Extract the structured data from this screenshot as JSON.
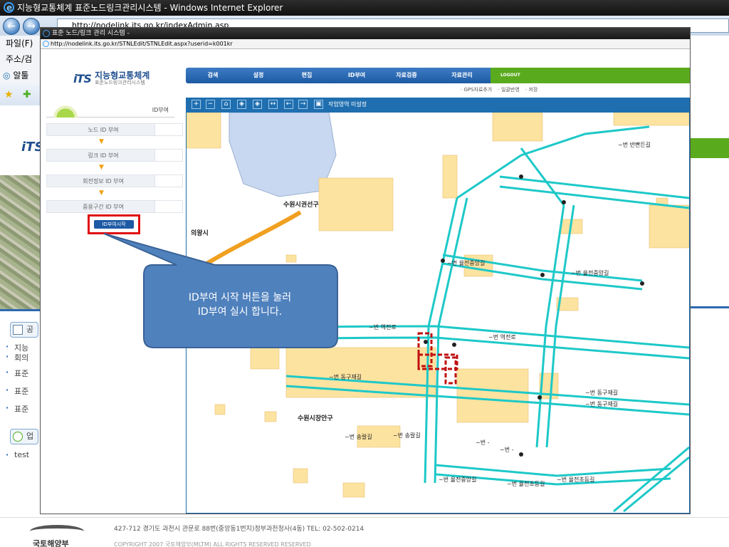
{
  "outer_window": {
    "title": "지능형교통체계 표준노드링크관리시스템 - Windows Internet Explorer",
    "address": "http://nodelink.its.go.kr/indexAdmin.asp",
    "menu_label": "파일(F)",
    "address_label": "주소/검",
    "links_label": "알툴"
  },
  "outer_page": {
    "logo_mark": "iTS",
    "news_items": [
      "지능",
      "회의",
      "표준",
      "표준",
      "표준"
    ],
    "news_title_1": "공",
    "news_title_2": "업",
    "news_item_bottom": "test"
  },
  "popup": {
    "title": "표준 노드/링크 관리 시스템 -",
    "address": "http://nodelink.its.go.kr/STNLEdit/STNLEdit.aspx?userid=k001kr"
  },
  "header": {
    "logo_mark": "iTS",
    "logo_title": "지능형교통체계",
    "logo_subtitle": "표준노드링크관리시스템",
    "nav": [
      "검색",
      "설정",
      "편집",
      "ID부여",
      "자료검증",
      "자료관리"
    ],
    "logout": "LOGOUT",
    "subnav": [
      "· GPS자료추가",
      "· 일괄반영",
      "· 저장"
    ]
  },
  "sidebar": {
    "title": "ID부여",
    "steps": [
      "노드 ID 부여",
      "링크 ID 부여",
      "회전정보 ID 부여",
      "중용구간 ID 부여"
    ],
    "arrow": "▼",
    "start_button": "ID부여시작"
  },
  "map": {
    "toolbar_label": "작업영역 미설정",
    "tools": [
      "+",
      "−",
      "⌂",
      "◈",
      "◈",
      "↔",
      "←",
      "→",
      "▣"
    ],
    "labels": {
      "district_1": "수원시권선구",
      "district_2": "수원시권선구",
      "district_3": "수원시장안구",
      "city": "의왕시",
      "road_1": "~번 반빤든길",
      "road_2": "~번 율전중앙길",
      "road_3": "~번 율전중앙길",
      "road_4": "~번 역전로",
      "road_5": "~번 역전로",
      "road_6": "~번 동구재길",
      "road_7": "~번 동구재길",
      "road_8": "~번 동구재길",
      "road_9": "~번 송랄길",
      "road_10": "~번 송랄길",
      "road_11": "~번 율전중앙길",
      "road_12": "~번 율전초등길",
      "road_13": "~번 율전초등길",
      "road_14": "~번 -",
      "road_15": "~번 -"
    },
    "colors": {
      "road": "#1ec8c8",
      "block": "#fde3a0",
      "water": "#c8d8f0",
      "highway": "#f0a020",
      "highlight": "#c01010"
    }
  },
  "callout": {
    "line_1": "ID부여  시작 버튼을 눌러",
    "line_2": "ID부여 실시 합니다.",
    "color": "#4f81bd"
  },
  "footer": {
    "org": "국토해양부",
    "address": "427-712 경기도 과천시 관문로 88번(중앙동1번지)정부과천청사(4동)  TEL: 02-502-0214",
    "copyright": "COPYRIGHT  2007 국토해양부(MLTM) ALL RIGHTS RESERVED   RESERVED"
  }
}
